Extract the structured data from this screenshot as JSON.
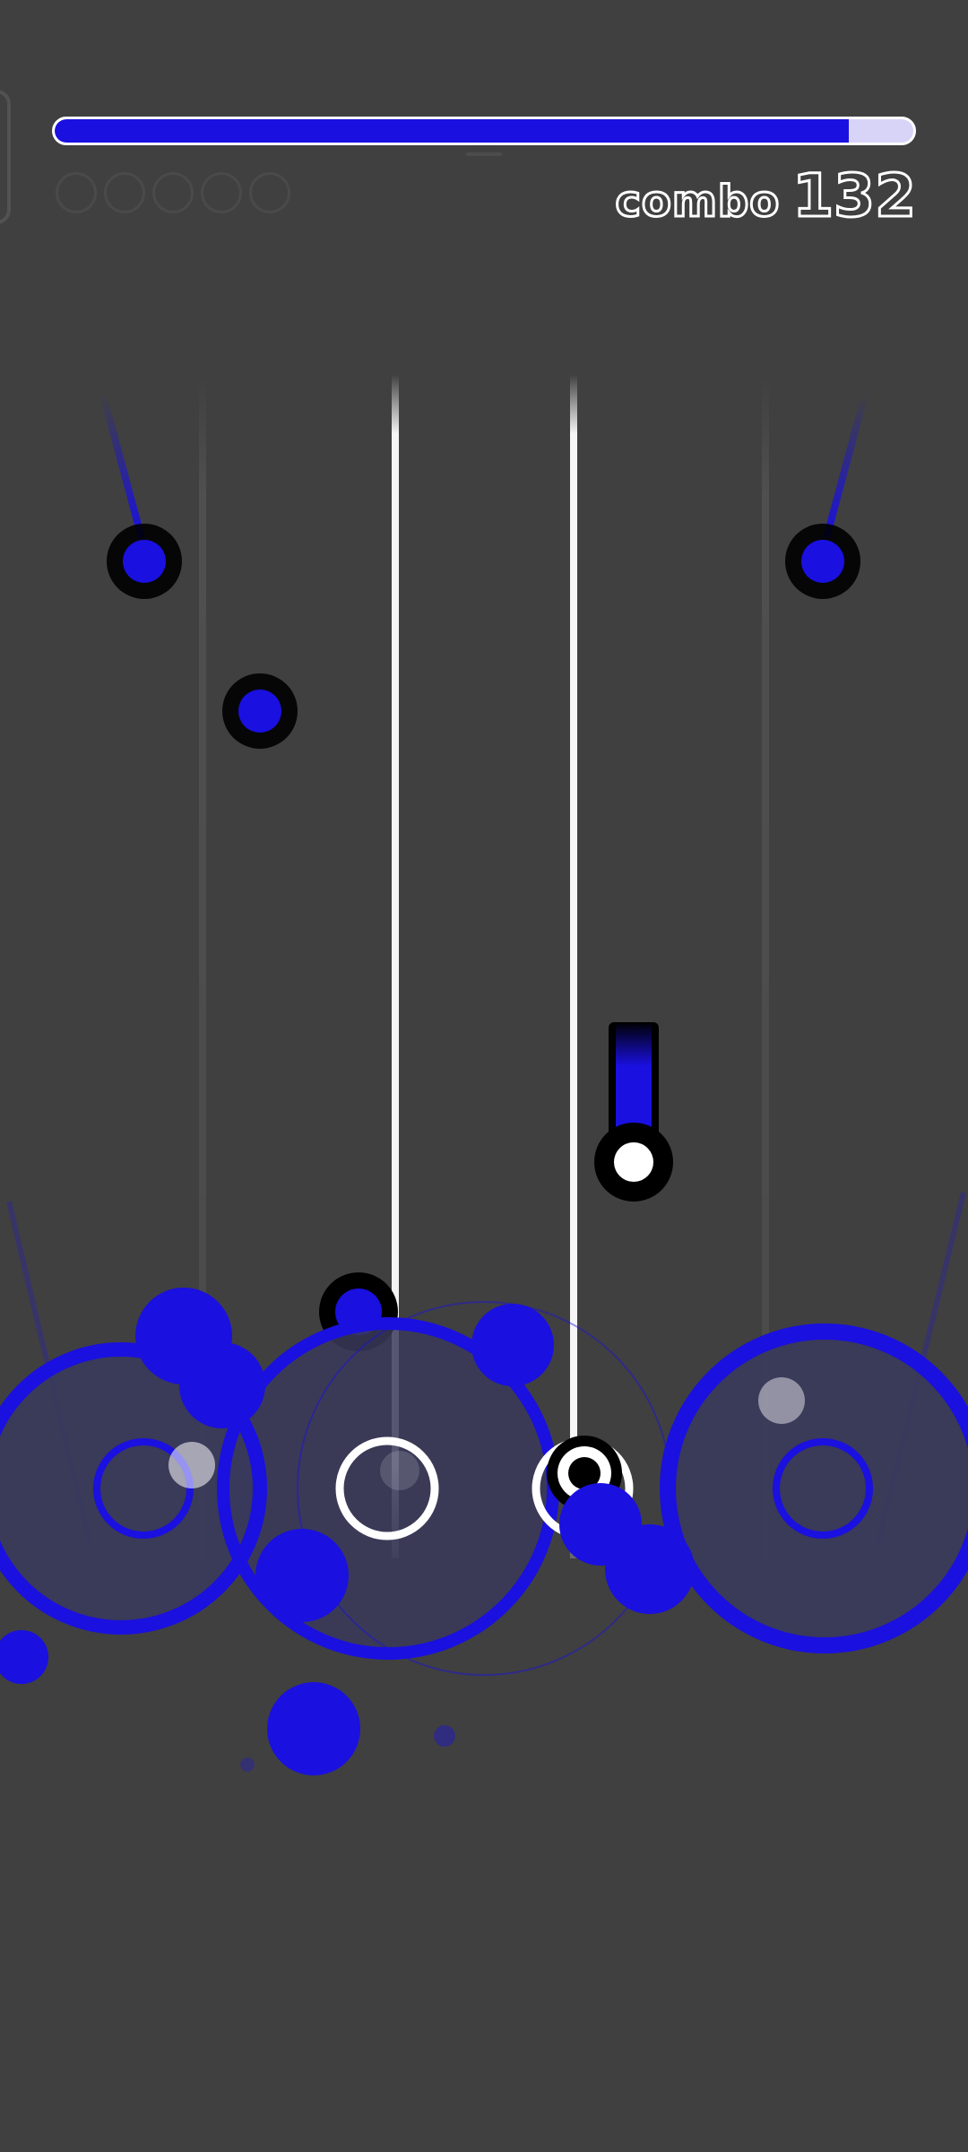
{
  "hud": {
    "combo_label": "combo",
    "combo_value": "132",
    "song_progress": 0.925,
    "judgement_dots": 5
  },
  "colors": {
    "background": "#404040",
    "accent_blue": "#1a10e0",
    "progress_track": "#d8d4f8",
    "lane_line": "#f4f4f4",
    "note_rim": "#000000",
    "white": "#ffffff"
  },
  "icons": {
    "pause": "pause-icon",
    "judgement": "circle-outline-icon"
  }
}
